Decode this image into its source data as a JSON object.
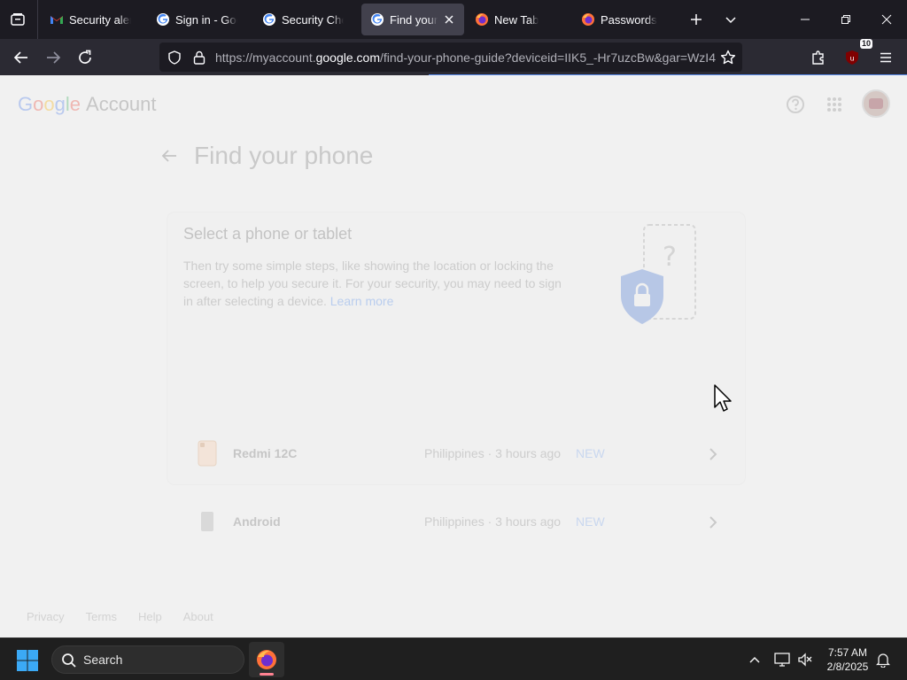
{
  "browser": {
    "tabs": [
      {
        "title": "Security alert",
        "favicon": "gmail-icon",
        "active": false
      },
      {
        "title": "Sign in - Google",
        "favicon": "google-icon",
        "active": false
      },
      {
        "title": "Security Checkup",
        "favicon": "google-icon",
        "active": false
      },
      {
        "title": "Find your phone",
        "favicon": "google-icon",
        "active": true
      },
      {
        "title": "New Tab",
        "favicon": "firefox-icon",
        "active": false
      },
      {
        "title": "Passwords",
        "favicon": "firefox-icon",
        "active": false
      }
    ],
    "url": {
      "prefix": "https://myaccount.",
      "host": "google.com",
      "path": "/find-your-phone-guide?deviceid=IIK5_-Hr7uzcBw&gar=WzI4"
    },
    "extension_badge": "10",
    "accent": "#5b8def"
  },
  "page": {
    "logo_letters": [
      "G",
      "o",
      "o",
      "g",
      "l",
      "e"
    ],
    "logo_suffix": "Account",
    "title": "Find your phone",
    "card": {
      "title": "Select a phone or tablet",
      "description": "Then try some simple steps, like showing the location or locking the screen, to help you secure it. For your security, you may need to sign in after selecting a device.",
      "learn_more": "Learn more"
    },
    "devices": [
      {
        "name": "Redmi 12C",
        "meta": "Philippines · 3 hours ago",
        "badge": "NEW",
        "icon": "phone-redmi-icon"
      },
      {
        "name": "Android",
        "meta": "Philippines · 3 hours ago",
        "badge": "NEW",
        "icon": "phone-android-icon"
      }
    ],
    "footer": [
      "Privacy",
      "Terms",
      "Help",
      "About"
    ]
  },
  "taskbar": {
    "search_label": "Search",
    "time": "7:57 AM",
    "date": "2/8/2025"
  }
}
